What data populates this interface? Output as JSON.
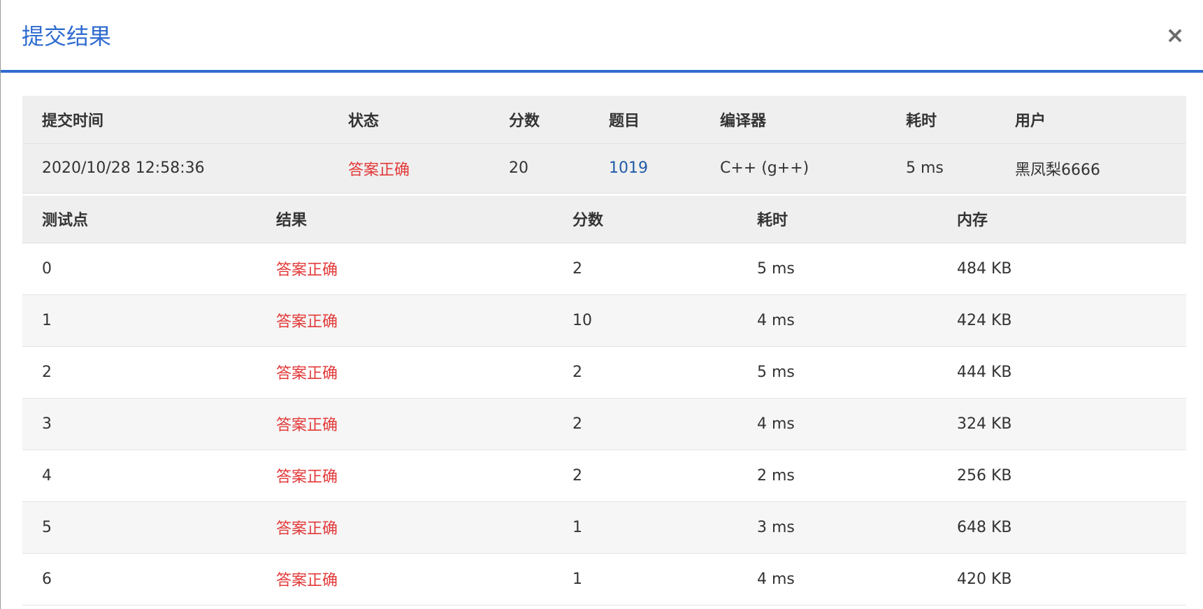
{
  "dialog": {
    "title": "提交结果",
    "close_label": "×"
  },
  "colors": {
    "accent": "#2f6bd0",
    "accepted": "#e33a3a",
    "link": "#1f5aa8"
  },
  "summary": {
    "headers": [
      "提交时间",
      "状态",
      "分数",
      "题目",
      "编译器",
      "耗时",
      "用户"
    ],
    "row": {
      "submit_time": "2020/10/28 12:58:36",
      "status": "答案正确",
      "score": "20",
      "problem": "1019",
      "compiler": "C++ (g++)",
      "time": "5 ms",
      "user": "黑凤梨6666"
    }
  },
  "cases": {
    "headers": [
      "测试点",
      "结果",
      "分数",
      "耗时",
      "内存"
    ],
    "rows": [
      {
        "id": "0",
        "result": "答案正确",
        "score": "2",
        "time": "5 ms",
        "memory": "484 KB"
      },
      {
        "id": "1",
        "result": "答案正确",
        "score": "10",
        "time": "4 ms",
        "memory": "424 KB"
      },
      {
        "id": "2",
        "result": "答案正确",
        "score": "2",
        "time": "5 ms",
        "memory": "444 KB"
      },
      {
        "id": "3",
        "result": "答案正确",
        "score": "2",
        "time": "4 ms",
        "memory": "324 KB"
      },
      {
        "id": "4",
        "result": "答案正确",
        "score": "2",
        "time": "2 ms",
        "memory": "256 KB"
      },
      {
        "id": "5",
        "result": "答案正确",
        "score": "1",
        "time": "3 ms",
        "memory": "648 KB"
      },
      {
        "id": "6",
        "result": "答案正确",
        "score": "1",
        "time": "4 ms",
        "memory": "420 KB"
      }
    ]
  }
}
